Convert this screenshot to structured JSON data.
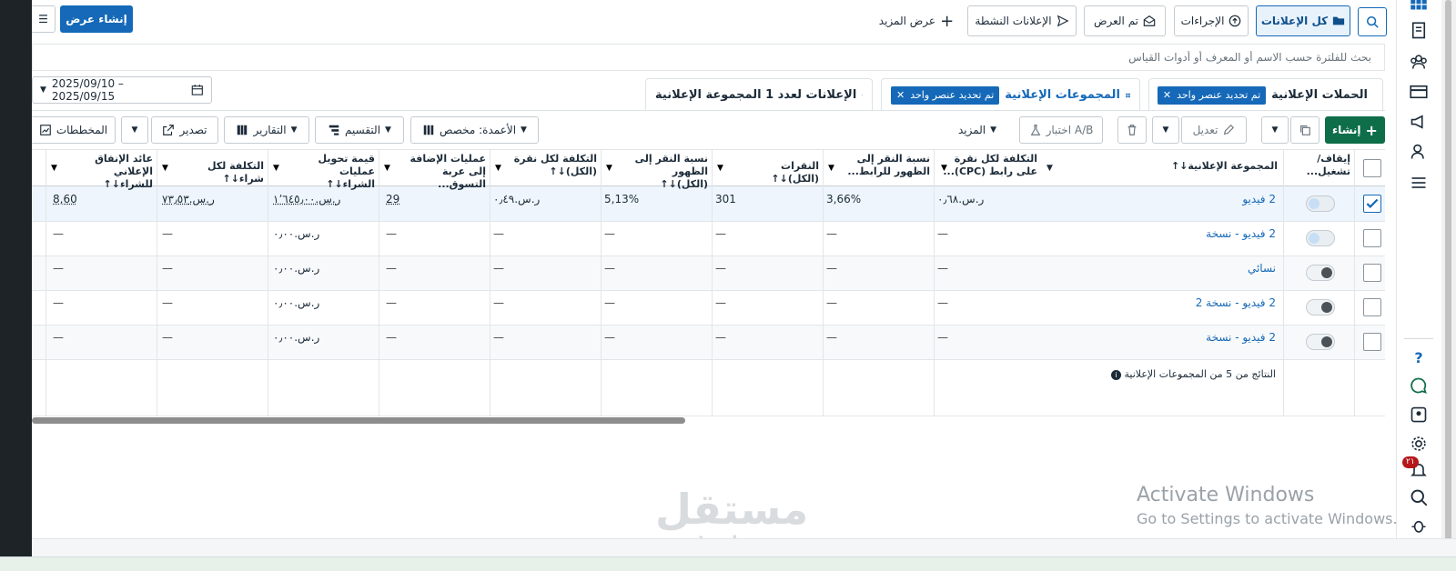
{
  "toolbar": {
    "search_icon": "search-icon",
    "all_ads": "كل الإعلانات",
    "actions": "الإجراءات",
    "displayed": "تم العرض",
    "active_ads": "الإعلانات النشطة",
    "show_more": "عرض المزيد",
    "create_offer": "إنشاء عرض"
  },
  "search": {
    "placeholder": "بحث للفلترة حسب الاسم أو المعرف أو أدوات القياس"
  },
  "tabs": {
    "campaigns": "الحملات الإعلانية",
    "campaigns_chip": "تم تحديد عنصر واحد",
    "ad_groups": "المجموعات الإعلانية",
    "ad_groups_chip": "تم تحديد عنصر واحد",
    "ads": "الإعلانات لعدد 1 المجموعة الإعلانية"
  },
  "date_range": "2025/09/10 – 2025/09/15",
  "actions": {
    "create": "إنشاء",
    "edit": "تعديل",
    "ab_test": "اختبار A/B",
    "more": "المزيد",
    "columns": "الأعمدة: مخصص",
    "breakdown": "التقسيم",
    "reports": "التقارير",
    "export": "تصدير",
    "charts": "المخططات"
  },
  "columns": [
    "إيقاف/ تشغيل...",
    "المجموعة الإعلانية↓↑",
    "التكلفة لكل نقرة على رابط (CPC)...",
    "نسبة النقر إلى الظهور للرابط...",
    "النقرات (الكل)↓↑",
    "نسبة النقر إلى الظهور (الكل)↓↑",
    "التكلفة لكل نقرة (الكل)↓↑",
    "عمليات الإضافة إلى عربة التسوق...",
    "قيمة تحويل عمليات الشراء↓↑",
    "التكلفة لكل شراء↓↑",
    "عائد الإنفاق الإعلاني للشراء↓↑"
  ],
  "rows": [
    {
      "name": "2 فيديو",
      "cpc": "ر.س.٠٫٦٨",
      "ctr_link": "3,66%",
      "clicks": "301",
      "ctr_all": "5,13%",
      "cpc_all": "ر.س.٠٫٤٩",
      "atc": "29",
      "conv_value": "ر.س.١٬٦٤٥٫٠٠",
      "cost_purchase": "ر.س.٧٣٫٥٣",
      "roas": "8,60"
    },
    {
      "name": "2 فيديو - نسخة",
      "cpc": "—",
      "ctr_link": "—",
      "clicks": "—",
      "ctr_all": "—",
      "cpc_all": "—",
      "atc": "—",
      "conv_value": "ر.س.٠٫٠٠",
      "cost_purchase": "—",
      "roas": "—"
    },
    {
      "name": "نسائي",
      "cpc": "—",
      "ctr_link": "—",
      "clicks": "—",
      "ctr_all": "—",
      "cpc_all": "—",
      "atc": "—",
      "conv_value": "ر.س.٠٫٠٠",
      "cost_purchase": "—",
      "roas": "—"
    },
    {
      "name": "2 فيديو - نسخة 2",
      "cpc": "—",
      "ctr_link": "—",
      "clicks": "—",
      "ctr_all": "—",
      "cpc_all": "—",
      "atc": "—",
      "conv_value": "ر.س.٠٫٠٠",
      "cost_purchase": "—",
      "roas": "—"
    },
    {
      "name": "2 فيديو - نسخة",
      "cpc": "—",
      "ctr_link": "—",
      "clicks": "—",
      "ctr_all": "—",
      "cpc_all": "—",
      "atc": "—",
      "conv_value": "ر.س.٠٫٠٠",
      "cost_purchase": "—",
      "roas": "—"
    }
  ],
  "footer_note": "النتائج من 5 من المجموعات الإعلانية",
  "notification_count": "٢١",
  "windows": {
    "line1": "Activate Windows",
    "line2": "Go to Settings to activate Windows."
  },
  "watermark": {
    "ar": "مستقل",
    "en": "mostaql.com"
  },
  "colors": {
    "primary": "#1569b8",
    "create_green": "#0e6e49"
  }
}
